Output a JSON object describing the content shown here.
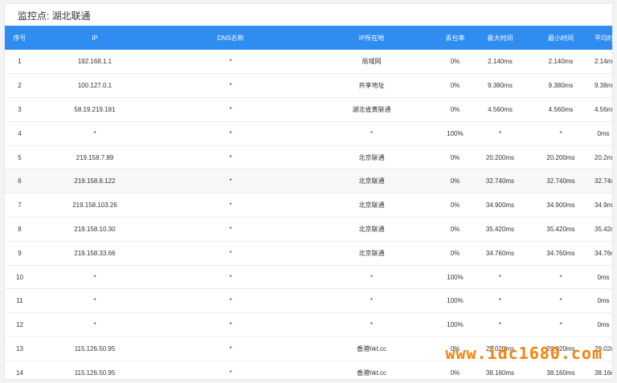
{
  "monitor": {
    "title": "监控点: 湖北联通"
  },
  "table": {
    "headers": [
      "序号",
      "IP",
      "DNS名称",
      "IP所在地",
      "丢包率",
      "最大时间",
      "最小时间",
      "平均时间"
    ],
    "rows": [
      [
        "1",
        "192.168.1.1",
        "*",
        "局域网",
        "0%",
        "2.140ms",
        "2.140ms",
        "2.14ms"
      ],
      [
        "2",
        "100.127.0.1",
        "*",
        "共享地址",
        "0%",
        "9.380ms",
        "9.380ms",
        "9.38ms"
      ],
      [
        "3",
        "58.19.219.181",
        "*",
        "湖北省黄联通",
        "0%",
        "4.560ms",
        "4.560ms",
        "4.56ms"
      ],
      [
        "4",
        "*",
        "*",
        "*",
        "100%",
        "*",
        "*",
        "0ms"
      ],
      [
        "5",
        "219.158.7.89",
        "*",
        "北京联通",
        "0%",
        "20.200ms",
        "20.200ms",
        "20.2ms"
      ],
      [
        "6",
        "219.158.8.122",
        "*",
        "北京联通",
        "0%",
        "32.740ms",
        "32.740ms",
        "32.74ms"
      ],
      [
        "7",
        "219.158.103.26",
        "*",
        "北京联通",
        "0%",
        "34.900ms",
        "34.900ms",
        "34.9ms"
      ],
      [
        "8",
        "219.158.10.30",
        "*",
        "北京联通",
        "0%",
        "35.420ms",
        "35.420ms",
        "35.42ms"
      ],
      [
        "9",
        "219.158.33.66",
        "*",
        "北京联通",
        "0%",
        "34.760ms",
        "34.760ms",
        "34.76ms"
      ],
      [
        "10",
        "*",
        "*",
        "*",
        "100%",
        "*",
        "*",
        "0ms"
      ],
      [
        "11",
        "*",
        "*",
        "*",
        "100%",
        "*",
        "*",
        "0ms"
      ],
      [
        "12",
        "*",
        "*",
        "*",
        "100%",
        "*",
        "*",
        "0ms"
      ],
      [
        "13",
        "115.126.50.95",
        "*",
        "香港hkt.cc",
        "0%",
        "29.020ms",
        "29.020ms",
        "29.02ms"
      ],
      [
        "14",
        "115.126.50.95",
        "*",
        "香港hkt.cc",
        "0%",
        "38.160ms",
        "38.160ms",
        "38.16ms"
      ]
    ],
    "highlighted_row": 6
  },
  "watermark": {
    "text": "www.idc1680.com"
  },
  "colors": {
    "header_bg": "#2f8cf0",
    "watermark": "#f57c00",
    "row_highlight": "#f6f7f9"
  }
}
